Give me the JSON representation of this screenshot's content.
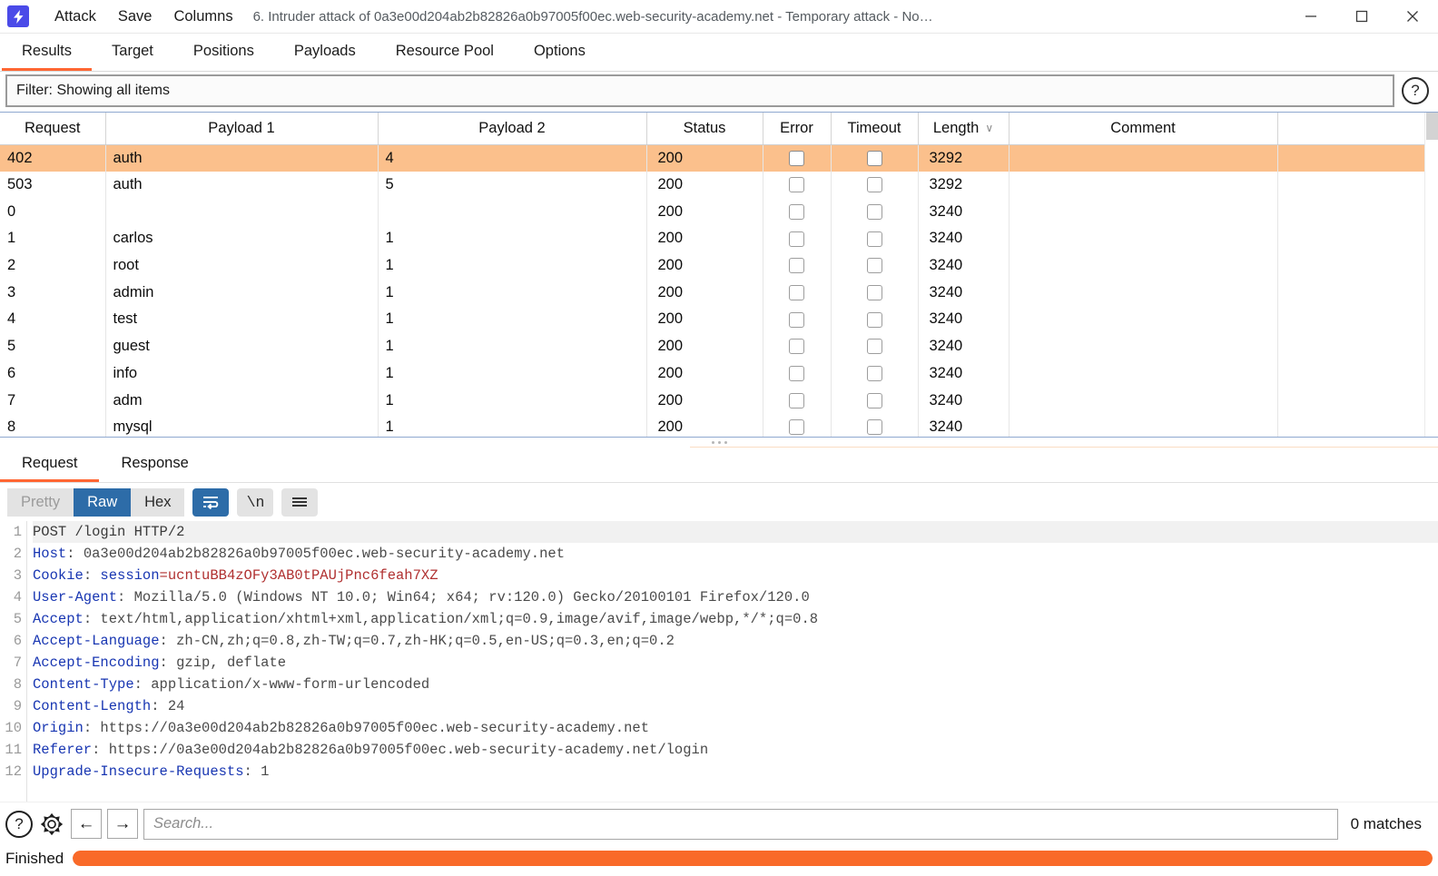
{
  "window": {
    "logo_glyph": "⚡",
    "title": "6. Intruder attack of 0a3e00d204ab2b82826a0b97005f00ec.web-security-academy.net - Temporary attack - No…",
    "menus": [
      "Attack",
      "Save",
      "Columns"
    ],
    "controls": {
      "minimize": "minimize",
      "maximize": "maximize",
      "close": "close"
    }
  },
  "top_tabs": [
    {
      "label": "Results",
      "active": true
    },
    {
      "label": "Target",
      "active": false
    },
    {
      "label": "Positions",
      "active": false
    },
    {
      "label": "Payloads",
      "active": false
    },
    {
      "label": "Resource Pool",
      "active": false
    },
    {
      "label": "Options",
      "active": false
    }
  ],
  "filter": {
    "text": "Filter: Showing all items",
    "help_glyph": "?"
  },
  "results_table": {
    "columns": [
      {
        "label": "Request",
        "sorted": false
      },
      {
        "label": "Payload 1",
        "sorted": false
      },
      {
        "label": "Payload 2",
        "sorted": false
      },
      {
        "label": "Status",
        "sorted": false
      },
      {
        "label": "Error",
        "sorted": false
      },
      {
        "label": "Timeout",
        "sorted": false
      },
      {
        "label": "Length",
        "sorted": true,
        "sort_caret": "∨"
      },
      {
        "label": "Comment",
        "sorted": false
      }
    ],
    "rows": [
      {
        "request": "402",
        "payload1": "auth",
        "payload2": "4",
        "status": "200",
        "error": false,
        "timeout": false,
        "length": "3292",
        "comment": "",
        "selected": true
      },
      {
        "request": "503",
        "payload1": "auth",
        "payload2": "5",
        "status": "200",
        "error": false,
        "timeout": false,
        "length": "3292",
        "comment": "",
        "selected": false
      },
      {
        "request": "0",
        "payload1": "",
        "payload2": "",
        "status": "200",
        "error": false,
        "timeout": false,
        "length": "3240",
        "comment": "",
        "selected": false
      },
      {
        "request": "1",
        "payload1": "carlos",
        "payload2": "1",
        "status": "200",
        "error": false,
        "timeout": false,
        "length": "3240",
        "comment": "",
        "selected": false
      },
      {
        "request": "2",
        "payload1": "root",
        "payload2": "1",
        "status": "200",
        "error": false,
        "timeout": false,
        "length": "3240",
        "comment": "",
        "selected": false
      },
      {
        "request": "3",
        "payload1": "admin",
        "payload2": "1",
        "status": "200",
        "error": false,
        "timeout": false,
        "length": "3240",
        "comment": "",
        "selected": false
      },
      {
        "request": "4",
        "payload1": "test",
        "payload2": "1",
        "status": "200",
        "error": false,
        "timeout": false,
        "length": "3240",
        "comment": "",
        "selected": false
      },
      {
        "request": "5",
        "payload1": "guest",
        "payload2": "1",
        "status": "200",
        "error": false,
        "timeout": false,
        "length": "3240",
        "comment": "",
        "selected": false
      },
      {
        "request": "6",
        "payload1": "info",
        "payload2": "1",
        "status": "200",
        "error": false,
        "timeout": false,
        "length": "3240",
        "comment": "",
        "selected": false
      },
      {
        "request": "7",
        "payload1": "adm",
        "payload2": "1",
        "status": "200",
        "error": false,
        "timeout": false,
        "length": "3240",
        "comment": "",
        "selected": false
      },
      {
        "request": "8",
        "payload1": "mysql",
        "payload2": "1",
        "status": "200",
        "error": false,
        "timeout": false,
        "length": "3240",
        "comment": "",
        "selected": false
      }
    ]
  },
  "detail_tabs": [
    {
      "label": "Request",
      "active": true
    },
    {
      "label": "Response",
      "active": false
    }
  ],
  "view_toolbar": {
    "pretty": "Pretty",
    "raw": "Raw",
    "hex": "Hex",
    "wrap_icon": "word-wrap-icon",
    "newline": "\\n",
    "menu_icon": "hamburger-icon"
  },
  "request_body": {
    "lines": [
      {
        "n": "1",
        "segments": [
          {
            "t": "POST /login HTTP/2",
            "c": "plain"
          }
        ]
      },
      {
        "n": "2",
        "segments": [
          {
            "t": "Host",
            "c": "hk"
          },
          {
            "t": ": 0a3e00d204ab2b82826a0b97005f00ec.web-security-academy.net",
            "c": "hv"
          }
        ]
      },
      {
        "n": "3",
        "segments": [
          {
            "t": "Cookie",
            "c": "hk"
          },
          {
            "t": ": ",
            "c": "hv"
          },
          {
            "t": "session",
            "c": "hcookie-name"
          },
          {
            "t": "=ucntuBB4zOFy3AB0tPAUjPnc6feah7XZ",
            "c": "hcookie-val"
          }
        ]
      },
      {
        "n": "4",
        "segments": [
          {
            "t": "User-Agent",
            "c": "hk"
          },
          {
            "t": ": Mozilla/5.0 (Windows NT 10.0; Win64; x64; rv:120.0) Gecko/20100101 Firefox/120.0",
            "c": "hv"
          }
        ]
      },
      {
        "n": "5",
        "segments": [
          {
            "t": "Accept",
            "c": "hk"
          },
          {
            "t": ": text/html,application/xhtml+xml,application/xml;q=0.9,image/avif,image/webp,*/*;q=0.8",
            "c": "hv"
          }
        ]
      },
      {
        "n": "6",
        "segments": [
          {
            "t": "Accept-Language",
            "c": "hk"
          },
          {
            "t": ": zh-CN,zh;q=0.8,zh-TW;q=0.7,zh-HK;q=0.5,en-US;q=0.3,en;q=0.2",
            "c": "hv"
          }
        ]
      },
      {
        "n": "7",
        "segments": [
          {
            "t": "Accept-Encoding",
            "c": "hk"
          },
          {
            "t": ": gzip, deflate",
            "c": "hv"
          }
        ]
      },
      {
        "n": "8",
        "segments": [
          {
            "t": "Content-Type",
            "c": "hk"
          },
          {
            "t": ": application/x-www-form-urlencoded",
            "c": "hv"
          }
        ]
      },
      {
        "n": "9",
        "segments": [
          {
            "t": "Content-Length",
            "c": "hk"
          },
          {
            "t": ": 24",
            "c": "hv"
          }
        ]
      },
      {
        "n": "10",
        "segments": [
          {
            "t": "Origin",
            "c": "hk"
          },
          {
            "t": ": https://0a3e00d204ab2b82826a0b97005f00ec.web-security-academy.net",
            "c": "hv"
          }
        ]
      },
      {
        "n": "11",
        "segments": [
          {
            "t": "Referer",
            "c": "hk"
          },
          {
            "t": ": https://0a3e00d204ab2b82826a0b97005f00ec.web-security-academy.net/login",
            "c": "hv"
          }
        ]
      },
      {
        "n": "12",
        "segments": [
          {
            "t": "Upgrade-Insecure-Requests",
            "c": "hk"
          },
          {
            "t": ": 1",
            "c": "hv"
          }
        ]
      }
    ]
  },
  "search": {
    "help_glyph": "?",
    "gear_icon": "gear-icon",
    "prev_glyph": "←",
    "next_glyph": "→",
    "placeholder": "Search...",
    "value": "",
    "matches": "0 matches"
  },
  "status": {
    "text": "Finished",
    "progress_percent": 100
  },
  "colors": {
    "accent": "#ff6633",
    "selection": "#fbc08c",
    "progress": "#f96a29",
    "active_button": "#2d6ca8",
    "header_key": "#1836b2",
    "cookie_value": "#b03030"
  }
}
